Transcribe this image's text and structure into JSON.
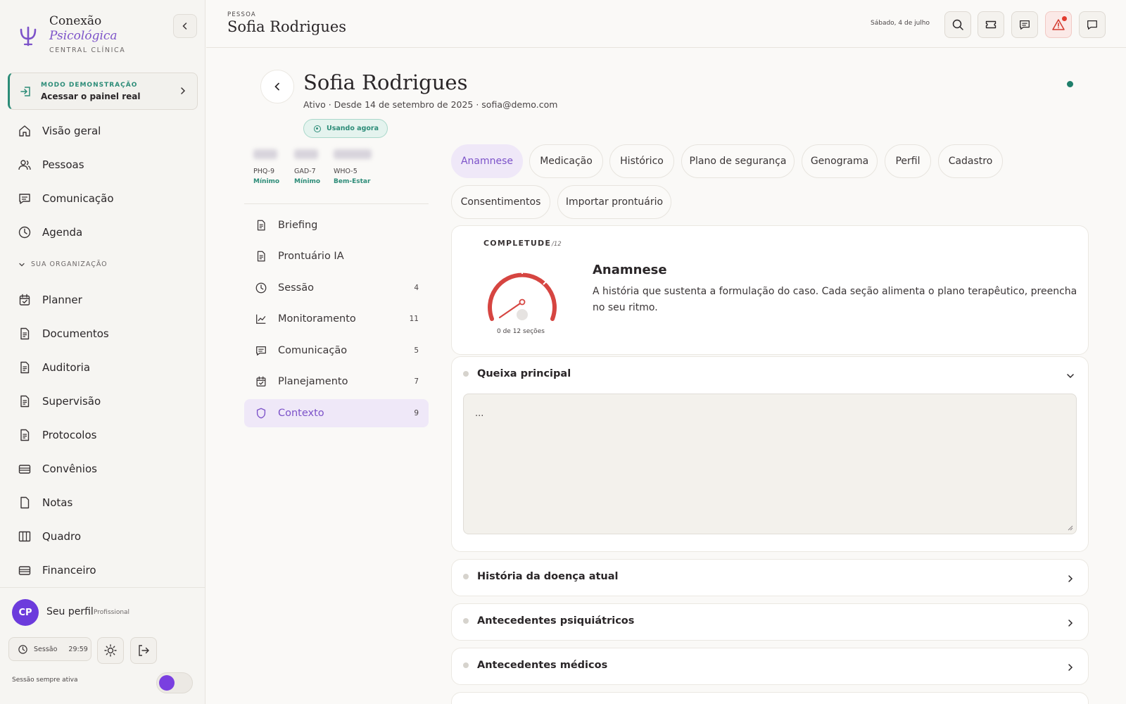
{
  "brand": {
    "name_line1": "Conexão",
    "name_line2": "Psicológica",
    "subtitle": "CENTRAL CLÍNICA"
  },
  "demo": {
    "tag": "MODO DEMONSTRAÇÃO",
    "text": "Acessar o painel real"
  },
  "nav": {
    "primary": [
      {
        "label": "Visão geral",
        "icon": "home-icon"
      },
      {
        "label": "Pessoas",
        "icon": "users-icon"
      },
      {
        "label": "Comunicação",
        "icon": "message-icon"
      },
      {
        "label": "Agenda",
        "icon": "clock-icon"
      }
    ],
    "section_title": "SUA ORGANIZAÇÃO",
    "org": [
      {
        "label": "Planner",
        "icon": "calendar-check-icon"
      },
      {
        "label": "Documentos",
        "icon": "document-icon"
      },
      {
        "label": "Auditoria",
        "icon": "document-icon"
      },
      {
        "label": "Supervisão",
        "icon": "document-icon"
      },
      {
        "label": "Protocolos",
        "icon": "document-icon"
      },
      {
        "label": "Convênios",
        "icon": "card-icon"
      },
      {
        "label": "Notas",
        "icon": "note-icon"
      },
      {
        "label": "Quadro",
        "icon": "board-icon"
      },
      {
        "label": "Financeiro",
        "icon": "card-icon"
      }
    ]
  },
  "profile": {
    "initials": "CP",
    "name": "Seu perfil",
    "role": "Profissional",
    "session_label": "Sessão",
    "session_time": "29:59",
    "always_active_label": "Sessão sempre ativa"
  },
  "topbar": {
    "tag": "PESSOA",
    "title": "Sofia Rodrigues",
    "date": "Sábado, 4 de julho"
  },
  "person": {
    "name": "Sofia Rodrigues",
    "meta": "Ativo · Desde 14 de setembro de 2025 · sofia@demo.com",
    "status": "Usando agora"
  },
  "scores": [
    {
      "name": "PHQ-9",
      "level": "Mínimo"
    },
    {
      "name": "GAD-7",
      "level": "Mínimo"
    },
    {
      "name": "WHO-5",
      "level": "Bem-Estar"
    }
  ],
  "subnav": [
    {
      "label": "Briefing",
      "count": "",
      "icon": "document-icon"
    },
    {
      "label": "Prontuário IA",
      "count": "",
      "icon": "document-icon"
    },
    {
      "label": "Sessão",
      "count": "4",
      "icon": "clock-icon"
    },
    {
      "label": "Monitoramento",
      "count": "11",
      "icon": "chart-line-icon"
    },
    {
      "label": "Comunicação",
      "count": "5",
      "icon": "message-icon"
    },
    {
      "label": "Planejamento",
      "count": "7",
      "icon": "calendar-check-icon"
    },
    {
      "label": "Contexto",
      "count": "9",
      "icon": "shield-icon"
    }
  ],
  "tabs": [
    "Anamnese",
    "Medicação",
    "Histórico",
    "Plano de segurança",
    "Genograma",
    "Perfil",
    "Cadastro",
    "Consentimentos",
    "Importar prontuário"
  ],
  "completeness": {
    "tag": "COMPLETUDE",
    "total_label": "/12",
    "title": "Anamnese",
    "description": "A história que sustenta a formulação do caso. Cada seção alimenta o plano terapêutico, preencha no seu ritmo.",
    "caption": "0 de 12 seções",
    "completed": 0,
    "total": 12
  },
  "sections": {
    "open": {
      "title": "Queixa principal",
      "placeholder": "..."
    },
    "collapsed": [
      "História da doença atual",
      "Antecedentes psiquiátricos",
      "Antecedentes médicos"
    ]
  },
  "colors": {
    "accent": "#7c52c9",
    "teal": "#2c8c78",
    "danger": "#e23b2e",
    "gauge": "#d64541"
  }
}
